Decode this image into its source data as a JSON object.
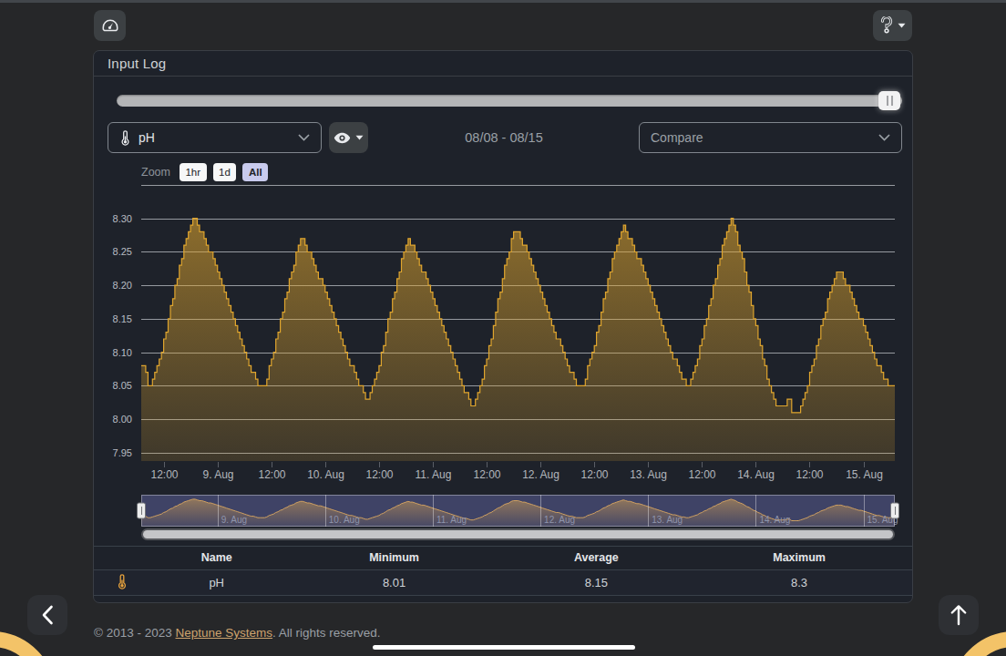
{
  "card": {
    "title": "Input Log"
  },
  "controls": {
    "probe_value": "pH",
    "date_range": "08/08 - 08/15",
    "compare_placeholder": "Compare"
  },
  "chart_data": {
    "type": "area",
    "title": "",
    "series_name": "pH",
    "zoom_label": "Zoom",
    "zoom_buttons": [
      "1hr",
      "1d",
      "All"
    ],
    "zoom_selected": "All",
    "x_start": "08/08 07:00",
    "x_end": "08/15 07:00",
    "x_step_hours": 0.5,
    "x_ticks": [
      {
        "t": 5,
        "label": "12:00"
      },
      {
        "t": 17,
        "label": "9. Aug"
      },
      {
        "t": 29,
        "label": "12:00"
      },
      {
        "t": 41,
        "label": "10. Aug"
      },
      {
        "t": 53,
        "label": "12:00"
      },
      {
        "t": 65,
        "label": "11. Aug"
      },
      {
        "t": 77,
        "label": "12:00"
      },
      {
        "t": 89,
        "label": "12. Aug"
      },
      {
        "t": 101,
        "label": "12:00"
      },
      {
        "t": 113,
        "label": "13. Aug"
      },
      {
        "t": 125,
        "label": "12:00"
      },
      {
        "t": 137,
        "label": "14. Aug"
      },
      {
        "t": 149,
        "label": "12:00"
      },
      {
        "t": 161,
        "label": "15. Aug"
      }
    ],
    "navigator_day_labels": [
      {
        "t": 17,
        "label": "9. Aug"
      },
      {
        "t": 41,
        "label": "10. Aug"
      },
      {
        "t": 65,
        "label": "11. Aug"
      },
      {
        "t": 89,
        "label": "12. Aug"
      },
      {
        "t": 113,
        "label": "13. Aug"
      },
      {
        "t": 137,
        "label": "14. Aug"
      },
      {
        "t": 161,
        "label": "15. Aug"
      }
    ],
    "y_ticks": [
      "8.30",
      "8.25",
      "8.20",
      "8.15",
      "8.10",
      "8.05",
      "8.00",
      "7.95"
    ],
    "ylim": [
      7.9376,
      8.35
    ],
    "grid": true,
    "colors": {
      "line": "#dfa52e",
      "fill_top": "rgba(223,165,46,0.57)",
      "fill_bottom": "rgba(223,165,46,0.17)",
      "gridline": "rgba(224,228,233,0.62)",
      "axis_label": "#b3b7bd",
      "y_label": "#b9bdc3",
      "navigator_bg": "#3f4366",
      "navigator_line": "#cfa061",
      "navigator_grid": "rgba(255,255,255,0.38)",
      "navigator_label": "#8f94ac",
      "scrollbar_track": "#56585d",
      "scrollbar_thumb": "#c4c5c8"
    },
    "values": [
      8.08,
      8.08,
      8.07,
      8.05,
      8.05,
      8.06,
      8.07,
      8.08,
      8.09,
      8.1,
      8.12,
      8.13,
      8.15,
      8.17,
      8.18,
      8.2,
      8.21,
      8.23,
      8.24,
      8.26,
      8.27,
      8.28,
      8.29,
      8.3,
      8.3,
      8.29,
      8.28,
      8.28,
      8.27,
      8.26,
      8.25,
      8.25,
      8.24,
      8.23,
      8.22,
      8.21,
      8.2,
      8.19,
      8.18,
      8.17,
      8.16,
      8.15,
      8.14,
      8.13,
      8.12,
      8.11,
      8.1,
      8.09,
      8.08,
      8.07,
      8.07,
      8.06,
      8.05,
      8.05,
      8.05,
      8.05,
      8.06,
      8.08,
      8.09,
      8.1,
      8.12,
      8.13,
      8.15,
      8.16,
      8.18,
      8.19,
      8.21,
      8.22,
      8.23,
      8.25,
      8.26,
      8.27,
      8.27,
      8.26,
      8.25,
      8.25,
      8.24,
      8.23,
      8.22,
      8.21,
      8.21,
      8.2,
      8.19,
      8.18,
      8.17,
      8.16,
      8.15,
      8.14,
      8.13,
      8.12,
      8.11,
      8.1,
      8.09,
      8.08,
      8.08,
      8.07,
      8.06,
      8.05,
      8.05,
      8.04,
      8.03,
      8.03,
      8.04,
      8.05,
      8.06,
      8.07,
      8.08,
      8.1,
      8.11,
      8.13,
      8.15,
      8.16,
      8.18,
      8.19,
      8.21,
      8.22,
      8.24,
      8.25,
      8.26,
      8.27,
      8.26,
      8.26,
      8.25,
      8.24,
      8.23,
      8.22,
      8.22,
      8.21,
      8.2,
      8.19,
      8.18,
      8.17,
      8.16,
      8.15,
      8.14,
      8.13,
      8.12,
      8.11,
      8.1,
      8.09,
      8.08,
      8.07,
      8.06,
      8.05,
      8.04,
      8.04,
      8.03,
      8.02,
      8.02,
      8.03,
      8.04,
      8.05,
      8.06,
      8.08,
      8.09,
      8.11,
      8.12,
      8.14,
      8.16,
      8.18,
      8.19,
      8.21,
      8.23,
      8.24,
      8.25,
      8.27,
      8.28,
      8.28,
      8.28,
      8.27,
      8.26,
      8.26,
      8.25,
      8.24,
      8.23,
      8.22,
      8.21,
      8.2,
      8.19,
      8.18,
      8.17,
      8.16,
      8.15,
      8.14,
      8.13,
      8.12,
      8.12,
      8.11,
      8.1,
      8.09,
      8.08,
      8.07,
      8.07,
      8.06,
      8.05,
      8.05,
      8.05,
      8.05,
      8.06,
      8.08,
      8.09,
      8.1,
      8.11,
      8.13,
      8.14,
      8.16,
      8.18,
      8.19,
      8.21,
      8.22,
      8.24,
      8.25,
      8.26,
      8.27,
      8.28,
      8.29,
      8.28,
      8.27,
      8.27,
      8.26,
      8.25,
      8.24,
      8.24,
      8.23,
      8.22,
      8.21,
      8.2,
      8.19,
      8.18,
      8.17,
      8.16,
      8.15,
      8.14,
      8.13,
      8.12,
      8.11,
      8.1,
      8.09,
      8.09,
      8.08,
      8.07,
      8.06,
      8.06,
      8.05,
      8.05,
      8.06,
      8.07,
      8.08,
      8.09,
      8.11,
      8.12,
      8.14,
      8.15,
      8.17,
      8.18,
      8.2,
      8.21,
      8.23,
      8.24,
      8.26,
      8.27,
      8.28,
      8.29,
      8.3,
      8.29,
      8.28,
      8.26,
      8.25,
      8.24,
      8.22,
      8.2,
      8.19,
      8.17,
      8.15,
      8.14,
      8.12,
      8.11,
      8.09,
      8.08,
      8.06,
      8.05,
      8.04,
      8.03,
      8.02,
      8.02,
      8.02,
      8.02,
      8.02,
      8.03,
      8.03,
      8.01,
      8.01,
      8.01,
      8.01,
      8.02,
      8.03,
      8.04,
      8.05,
      8.07,
      8.08,
      8.09,
      8.11,
      8.12,
      8.14,
      8.15,
      8.16,
      8.18,
      8.19,
      8.2,
      8.21,
      8.22,
      8.22,
      8.22,
      8.21,
      8.2,
      8.2,
      8.19,
      8.18,
      8.17,
      8.16,
      8.15,
      8.15,
      8.14,
      8.13,
      8.12,
      8.11,
      8.1,
      8.09,
      8.08,
      8.08,
      8.07,
      8.06,
      8.06,
      8.05,
      8.05,
      8.05,
      8.05
    ]
  },
  "table": {
    "headers": [
      "Name",
      "Minimum",
      "Average",
      "Maximum"
    ],
    "row": {
      "icon": "thermometer",
      "name": "pH",
      "minimum": "8.01",
      "average": "8.15",
      "maximum": "8.3"
    }
  },
  "footer": {
    "prefix": "© 2013 - 2023 ",
    "link": "Neptune Systems",
    "suffix": ". All rights reserved."
  }
}
